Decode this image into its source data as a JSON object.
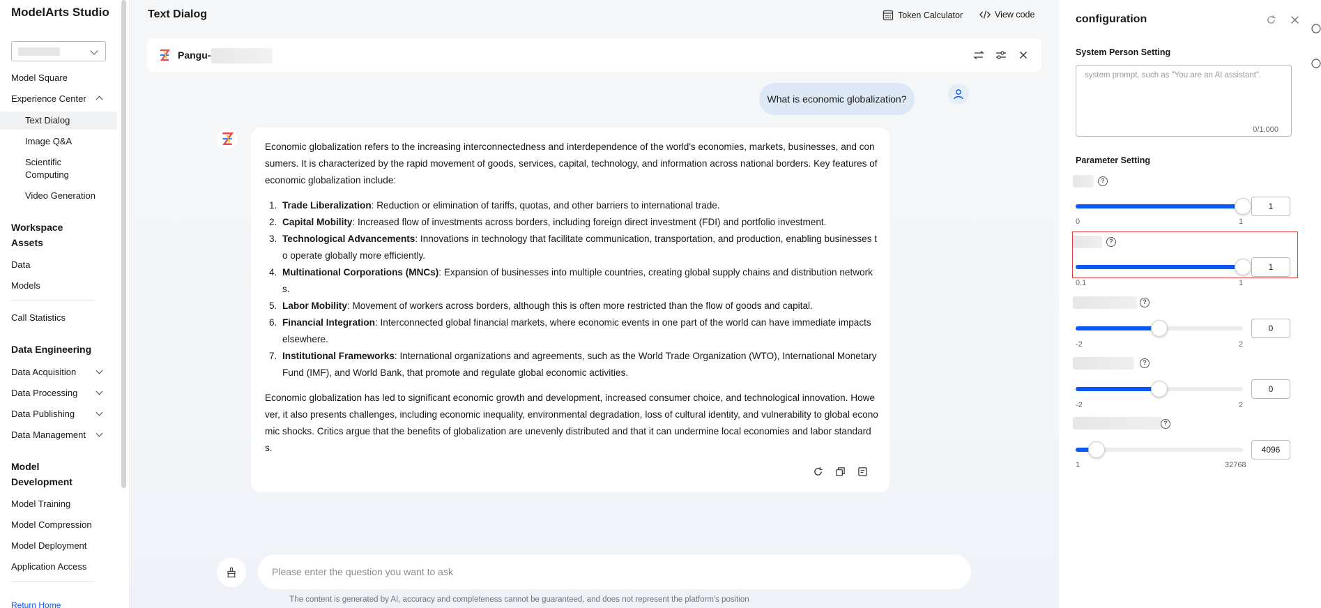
{
  "sidebar": {
    "brand": "ModelArts Studio",
    "items": {
      "model_square": "Model Square",
      "experience_center": "Experience Center",
      "text_dialog": "Text Dialog",
      "image_qa": "Image Q&A",
      "scientific_computing": "Scientific Computing",
      "video_generation": "Video Generation",
      "workspace_assets": "Workspace Assets",
      "data": "Data",
      "models": "Models",
      "call_statistics": "Call Statistics",
      "data_engineering": "Data Engineering",
      "data_acquisition": "Data Acquisition",
      "data_processing": "Data Processing",
      "data_publishing": "Data Publishing",
      "data_management": "Data Management",
      "model_development": "Model Development",
      "model_training": "Model Training",
      "model_compression": "Model Compression",
      "model_deployment": "Model Deployment",
      "application_access": "Application Access",
      "return_home": "Return Home"
    }
  },
  "main": {
    "title": "Text Dialog",
    "token_calculator": "Token Calculator",
    "view_code": "View code",
    "model_name": "Pangu-",
    "user_question": "What is economic globalization?",
    "answer": {
      "intro": "Economic globalization refers to the increasing interconnectedness and interdependence of the world's economies, markets, businesses, and consumers. It is characterized by the rapid movement of goods, services, capital, technology, and information across national borders. Key features of economic globalization include:",
      "items": [
        {
          "num": "1.",
          "title": "Trade Liberalization",
          "text": ": Reduction or elimination of tariffs, quotas, and other barriers to international trade."
        },
        {
          "num": "2.",
          "title": "Capital Mobility",
          "text": ": Increased flow of investments across borders, including foreign direct investment (FDI) and portfolio investment."
        },
        {
          "num": "3.",
          "title": "Technological Advancements",
          "text": ": Innovations in technology that facilitate communication, transportation, and production, enabling businesses to operate globally more efficiently."
        },
        {
          "num": "4.",
          "title": "Multinational Corporations (MNCs)",
          "text": ": Expansion of businesses into multiple countries, creating global supply chains and distribution networks."
        },
        {
          "num": "5.",
          "title": "Labor Mobility",
          "text": ": Movement of workers across borders, although this is often more restricted than the flow of goods and capital."
        },
        {
          "num": "6.",
          "title": "Financial Integration",
          "text": ": Interconnected global financial markets, where economic events in one part of the world can have immediate impacts elsewhere."
        },
        {
          "num": "7.",
          "title": "Institutional Frameworks",
          "text": ": International organizations and agreements, such as the World Trade Organization (WTO), International Monetary Fund (IMF), and World Bank, that promote and regulate global economic activities."
        }
      ],
      "conclusion": "Economic globalization has led to significant economic growth and development, increased consumer choice, and technological innovation. However, it also presents challenges, including economic inequality, environmental degradation, loss of cultural identity, and vulnerability to global economic shocks. Critics argue that the benefits of globalization are unevenly distributed and that it can undermine local economies and labor standards."
    },
    "input_placeholder": "Please enter the question you want to ask",
    "disclaimer": "The content is generated by AI, accuracy and completeness cannot be guaranteed, and does not represent the platform's position"
  },
  "config": {
    "title": "configuration",
    "system_setting_label": "System Person Setting",
    "system_placeholder": "system prompt, such as \"You are an AI assistant\".",
    "system_count": "0/1,000",
    "parameter_label": "Parameter Setting",
    "params": [
      {
        "min": "0",
        "max": "1",
        "value": "1",
        "fraction": 1.0
      },
      {
        "min": "0.1",
        "max": "1",
        "value": "1",
        "fraction": 1.0
      },
      {
        "min": "-2",
        "max": "2",
        "value": "0",
        "fraction": 0.5
      },
      {
        "min": "-2",
        "max": "2",
        "value": "0",
        "fraction": 0.5
      },
      {
        "min": "1",
        "max": "32768",
        "value": "4096",
        "fraction": 0.125
      }
    ]
  },
  "colors": {
    "accent": "#0a59f7",
    "highlight": "#e53e3e"
  }
}
